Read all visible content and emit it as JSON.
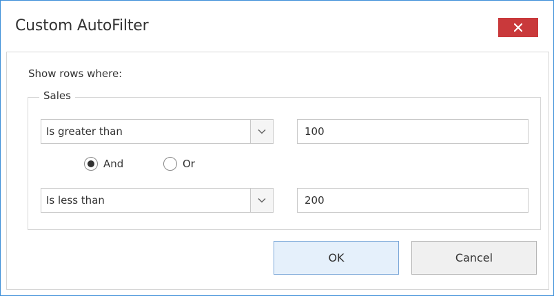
{
  "dialog": {
    "title": "Custom AutoFilter",
    "close_icon": "close-icon",
    "prompt": "Show rows where:",
    "group_label": "Sales",
    "condition1": {
      "operator": "Is greater than",
      "value": "100"
    },
    "logic": {
      "and_label": "And",
      "or_label": "Or",
      "selected": "And"
    },
    "condition2": {
      "operator": "Is less than",
      "value": "200"
    },
    "ok_label": "OK",
    "cancel_label": "Cancel"
  },
  "colors": {
    "window_border": "#3c8ed8",
    "close_button": "#c9393b",
    "ok_button_bg": "#e5f0fb",
    "ok_button_border": "#7aa7d8"
  }
}
